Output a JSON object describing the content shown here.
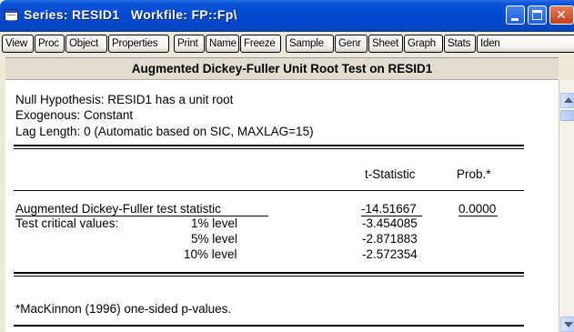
{
  "window": {
    "title": "Series: RESID1   Workfile: FP::Fp\\"
  },
  "toolbar": {
    "buttons": [
      "View",
      "Proc",
      "Object",
      "Properties",
      "Print",
      "Name",
      "Freeze",
      "Sample",
      "Genr",
      "Sheet",
      "Graph",
      "Stats",
      "Iden"
    ]
  },
  "output": {
    "header": "Augmented Dickey-Fuller Unit Root Test on RESID1",
    "null_hypothesis": "Null Hypothesis: RESID1 has a unit root",
    "exogenous": "Exogenous: Constant",
    "lag_length": "Lag Length: 0 (Automatic based on SIC, MAXLAG=15)",
    "col_tstat": "t-Statistic",
    "col_prob": "Prob.*",
    "adf_label": "Augmented Dickey-Fuller test statistic",
    "adf_tstat": "-14.51667",
    "adf_prob": "0.0000",
    "crit_label": "Test critical values:",
    "crit_rows": [
      {
        "level": "1% level",
        "value": "-3.454085"
      },
      {
        "level": "5% level",
        "value": "-2.871883"
      },
      {
        "level": "10% level",
        "value": "-2.572354"
      }
    ],
    "footnote": "*MacKinnon (1996) one-sided p-values."
  }
}
